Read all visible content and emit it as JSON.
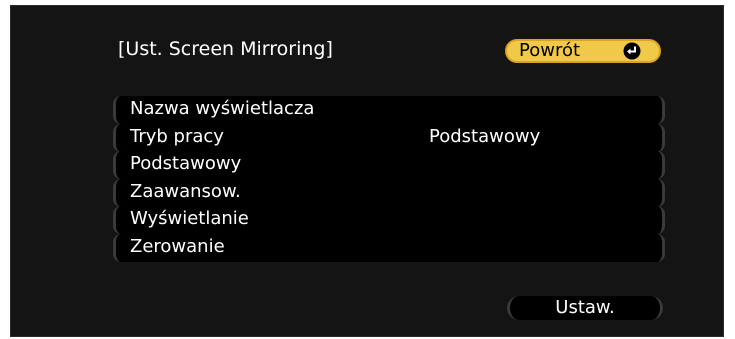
{
  "window": {
    "title": "[Ust. Screen Mirroring]"
  },
  "back_button": {
    "label": "Powrót",
    "icon": "enter-icon"
  },
  "menu": {
    "items": [
      {
        "label": "Nazwa wyświetlacza",
        "value": ""
      },
      {
        "label": "Tryb pracy",
        "value": "Podstawowy"
      },
      {
        "label": "Podstawowy",
        "value": ""
      },
      {
        "label": "Zaawansow.",
        "value": ""
      },
      {
        "label": "Wyświetlanie",
        "value": ""
      },
      {
        "label": "Zerowanie",
        "value": ""
      }
    ]
  },
  "set_button": {
    "label": "Ustaw."
  },
  "colors": {
    "background": "#141414",
    "menu_row": "#000000",
    "highlight": "#f0c84a",
    "text": "#ffffff"
  }
}
